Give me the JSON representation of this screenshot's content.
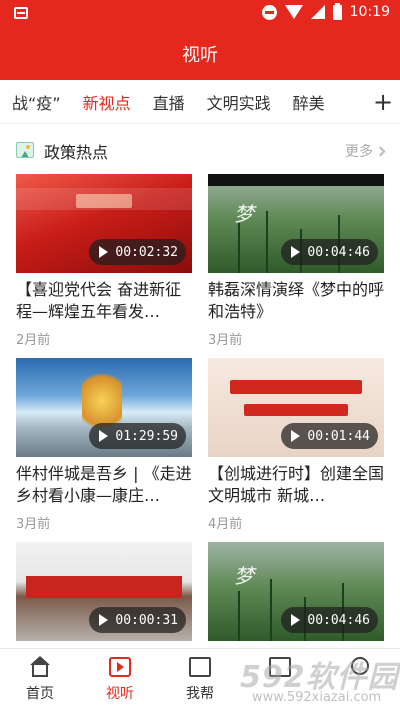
{
  "status_bar": {
    "time": "10:19",
    "icons": [
      "notification-icon",
      "dnd-icon",
      "wifi-icon",
      "signal-icon",
      "battery-icon"
    ]
  },
  "header": {
    "title": "视听"
  },
  "tabs": {
    "items": [
      "战“疫”",
      "新视点",
      "直播",
      "文明实践",
      "醉美"
    ],
    "active": "新视点",
    "add_icon": "plus-icon"
  },
  "section": {
    "title": "政策热点",
    "more": "更多",
    "icon": "image-icon"
  },
  "videos": [
    {
      "title": "【喜迎党代会  奋进新征程—辉煌五年看发…",
      "duration": "00:02:32",
      "time": "2月前"
    },
    {
      "title": "韩磊深情演绎《梦中的呼和浩特》",
      "duration": "00:04:46",
      "time": "3月前"
    },
    {
      "title": "伴村伴城是吾乡 | 《走进乡村看小康—康庄…",
      "duration": "01:29:59",
      "time": "3月前"
    },
    {
      "title": "【创城进行时】创建全国文明城市  新城…",
      "duration": "00:01:44",
      "time": "4月前"
    },
    {
      "title": "",
      "duration": "00:00:31",
      "time": ""
    },
    {
      "title": "",
      "duration": "00:04:46",
      "time": ""
    }
  ],
  "bottom_nav": {
    "items": [
      {
        "label": "首页",
        "icon": "home-icon"
      },
      {
        "label": "视听",
        "icon": "video-icon"
      },
      {
        "label": "我帮",
        "icon": "help-icon"
      },
      {
        "label": "",
        "icon": "grid-icon"
      },
      {
        "label": "",
        "icon": "user-icon"
      }
    ],
    "active": "视听"
  },
  "watermark": {
    "brand": "592软件园",
    "url": "www.592xiazai.com"
  },
  "colors": {
    "brand_red": "#e5281e",
    "text": "#222222",
    "muted": "#999999"
  }
}
